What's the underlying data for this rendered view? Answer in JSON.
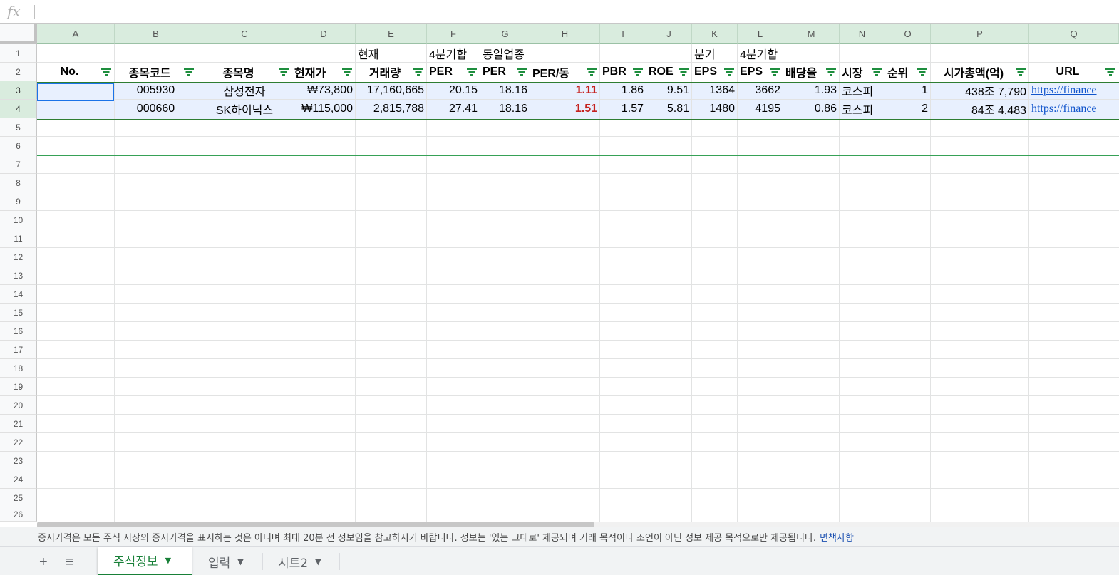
{
  "formula_bar": {
    "icon": "fx",
    "value": ""
  },
  "columns": [
    "A",
    "B",
    "C",
    "D",
    "E",
    "F",
    "G",
    "H",
    "I",
    "J",
    "K",
    "L",
    "M",
    "N",
    "O",
    "P",
    "Q"
  ],
  "rows": [
    "1",
    "2",
    "3",
    "4",
    "5",
    "6",
    "7",
    "8",
    "9",
    "10",
    "11",
    "12",
    "13",
    "14",
    "15",
    "16",
    "17",
    "18",
    "19",
    "20",
    "21",
    "22",
    "23",
    "24",
    "25",
    "26"
  ],
  "header_top": {
    "E": "현재",
    "F": "4분기합",
    "G": "동일업종",
    "K": "분기",
    "L": "4분기합"
  },
  "headers": {
    "A": "No.",
    "B": "종목코드",
    "C": "종목명",
    "D": "현재가",
    "E": "거래량",
    "F": "PER",
    "G": "PER",
    "H": "PER/동",
    "I": "PBR",
    "J": "ROE",
    "K": "EPS",
    "L": "EPS",
    "M": "배당율",
    "N": "시장",
    "O": "순위",
    "P": "시가총액(억)",
    "Q": "URL"
  },
  "data_rows": [
    {
      "A": "",
      "B": "005930",
      "C": "삼성전자",
      "D": "₩73,800",
      "E": "17,160,665",
      "F": "20.15",
      "G": "18.16",
      "H": "1.11",
      "I": "1.86",
      "J": "9.51",
      "K": "1364",
      "L": "3662",
      "M": "1.93",
      "N": "코스피",
      "O": "1",
      "P": "438조 7,790",
      "Q": "https://finance"
    },
    {
      "A": "",
      "B": "000660",
      "C": "SK하이닉스",
      "D": "₩115,000",
      "E": "2,815,788",
      "F": "27.41",
      "G": "18.16",
      "H": "1.51",
      "I": "1.57",
      "J": "5.81",
      "K": "1480",
      "L": "4195",
      "M": "0.86",
      "N": "코스피",
      "O": "2",
      "P": "84조 4,483",
      "Q": "https://finance"
    }
  ],
  "notice": {
    "text": "증시가격은 모든 주식 시장의 증시가격을 표시하는 것은 아니며 최대 20분 전 정보임을 참고하시기 바랍니다. 정보는 '있는 그대로' 제공되며 거래 목적이나 조언이 아닌 정보 제공 목적으로만 제공됩니다.",
    "link": "면책사항"
  },
  "sheets": [
    {
      "label": "주식정보",
      "active": true
    },
    {
      "label": "입력",
      "active": false
    },
    {
      "label": "시트2",
      "active": false
    }
  ],
  "tab_buttons": {
    "add": "+",
    "all_sheets": "≡"
  },
  "colors": {
    "accent": "#188038",
    "highlight_red": "#c5221f",
    "link": "#1155cc",
    "selection": "#e8f0fe"
  }
}
